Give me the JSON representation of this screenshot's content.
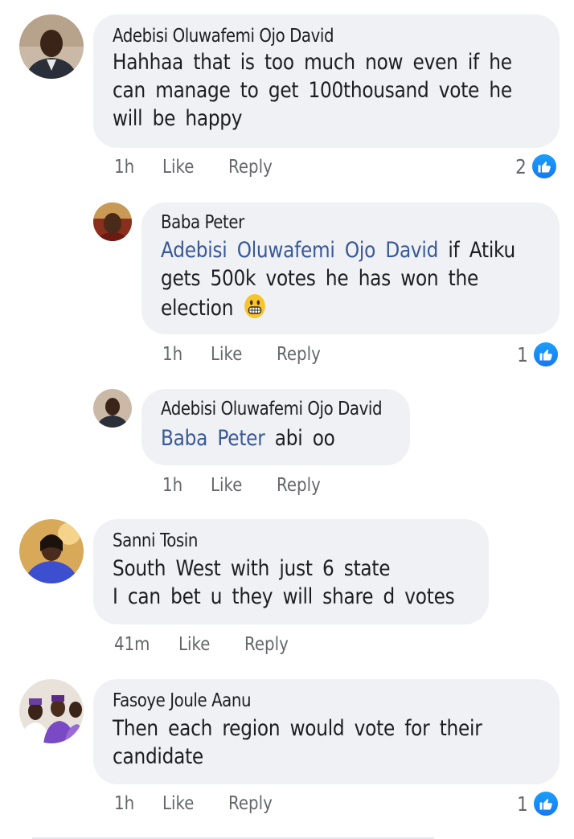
{
  "comments": [
    {
      "author": "Adebisi Oluwafemi Ojo David",
      "lines": [
        "Hahhaa that is too much now even if he",
        "can manage to get 100thousand vote he",
        "will be happy"
      ],
      "time": "1h",
      "like_label": "Like",
      "reply_label": "Reply",
      "reactions": "2"
    },
    {
      "author": "Baba Peter",
      "mention": "Adebisi Oluwafemi Ojo David",
      "line1_rest": " if Atiku",
      "line2": "gets 500k votes he has won the",
      "line3": "election",
      "emoji": "grinning-face-icon",
      "time": "1h",
      "like_label": "Like",
      "reply_label": "Reply",
      "reactions": "1"
    },
    {
      "author": "Adebisi Oluwafemi Ojo David",
      "mention": "Baba Peter",
      "line1_rest": " abi oo",
      "time": "1h",
      "like_label": "Like",
      "reply_label": "Reply"
    },
    {
      "author": "Sanni Tosin",
      "lines": [
        "South West with just 6 state",
        "I can bet u they will share d votes"
      ],
      "time": "41m",
      "like_label": "Like",
      "reply_label": "Reply"
    },
    {
      "author": "Fasoye Joule Aanu",
      "lines": [
        "Then each region would vote for their",
        "candidate"
      ],
      "time": "1h",
      "like_label": "Like",
      "reply_label": "Reply",
      "reactions": "1"
    }
  ],
  "colors": {
    "bubble": "#eff1f4",
    "mention": "#385898",
    "meta": "#65676b",
    "like_badge": "#1877f2"
  }
}
